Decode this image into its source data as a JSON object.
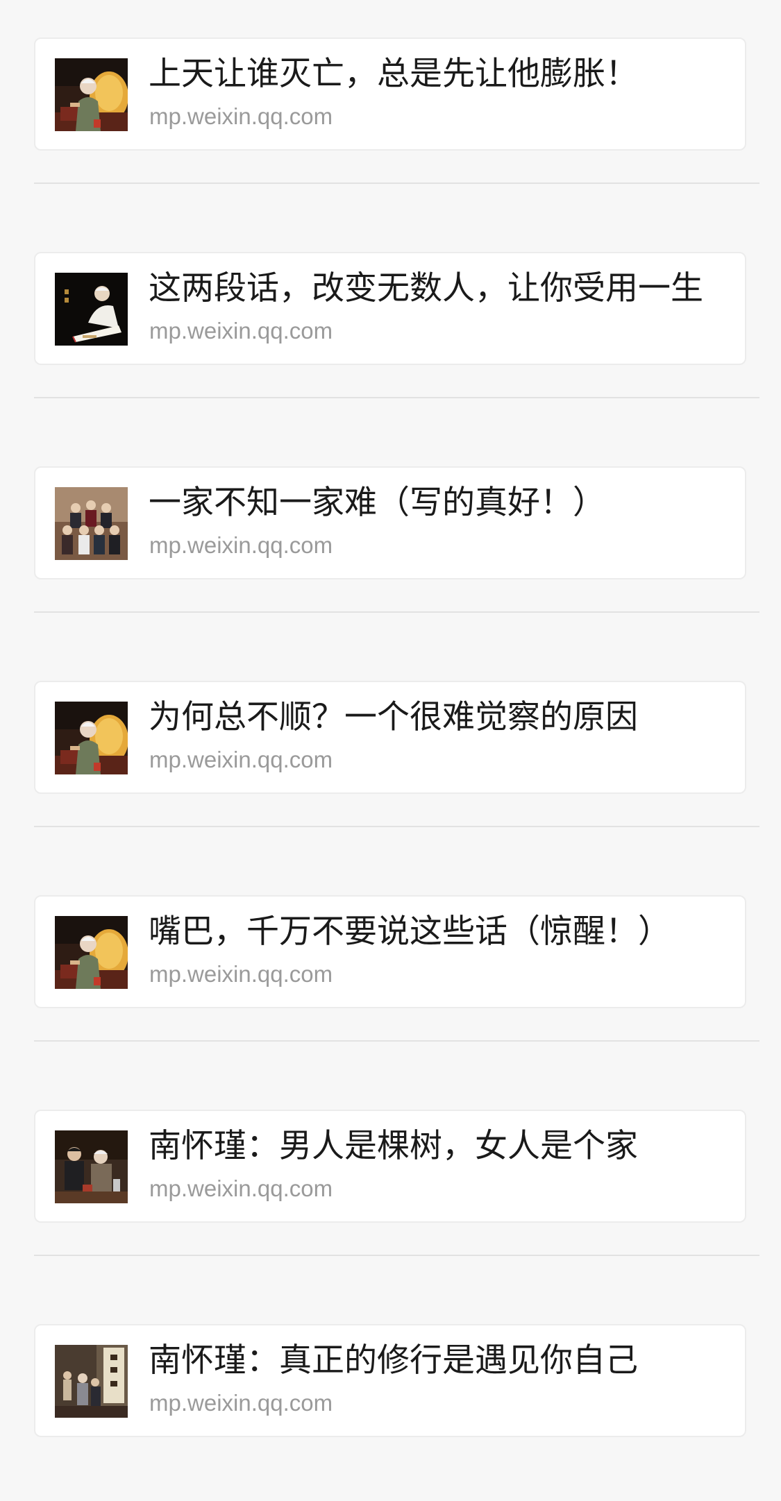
{
  "colors": {
    "background": "#f7f7f7",
    "card": "#ffffff",
    "title": "#1a1a1a",
    "source": "#9a9a9a",
    "divider": "#e2e2e2"
  },
  "articles": [
    {
      "title": "上天让谁灭亡，总是先让他膨胀！",
      "source": "mp.weixin.qq.com",
      "thumbnail_icon": "elderly-man-yellow-chair-photo"
    },
    {
      "title": "这两段话，改变无数人，让你受用一生",
      "source": "mp.weixin.qq.com",
      "thumbnail_icon": "elderly-man-calligraphy-photo"
    },
    {
      "title": "一家不知一家难（写的真好！）",
      "source": "mp.weixin.qq.com",
      "thumbnail_icon": "family-group-photo"
    },
    {
      "title": "为何总不顺？一个很难觉察的原因",
      "source": "mp.weixin.qq.com",
      "thumbnail_icon": "elderly-man-yellow-chair-photo"
    },
    {
      "title": "嘴巴，千万不要说这些话（惊醒！）",
      "source": "mp.weixin.qq.com",
      "thumbnail_icon": "elderly-man-yellow-chair-photo"
    },
    {
      "title": "南怀瑾：男人是棵树，女人是个家",
      "source": "mp.weixin.qq.com",
      "thumbnail_icon": "two-men-seated-photo"
    },
    {
      "title": "南怀瑾：真正的修行是遇见你自己",
      "source": "mp.weixin.qq.com",
      "thumbnail_icon": "lecture-hall-calligraphy-photo"
    }
  ]
}
